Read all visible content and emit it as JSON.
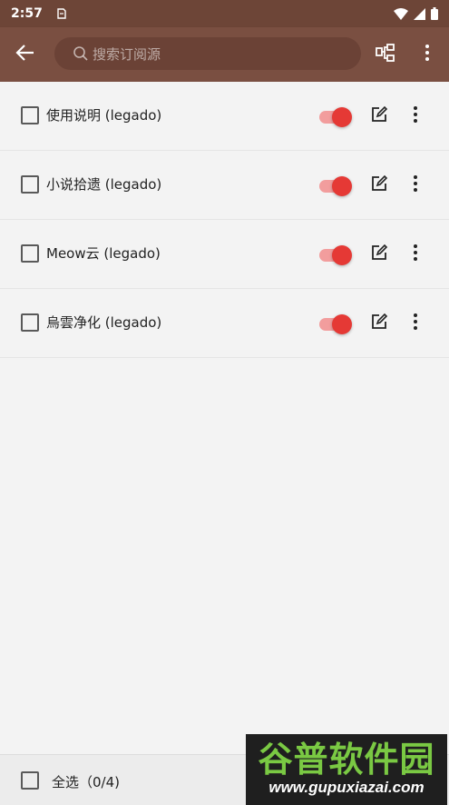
{
  "status_bar": {
    "time": "2:57",
    "notification_icon": "notification-icon",
    "wifi_icon": "wifi-icon",
    "signal_icon": "signal-icon",
    "battery_icon": "battery-icon"
  },
  "toolbar": {
    "back_icon": "arrow-left-icon",
    "search_placeholder": "搜索订阅源",
    "group_icon": "group-icon",
    "menu_icon": "more-vert-icon",
    "background_color": "#7a4f41"
  },
  "items": [
    {
      "label": "使用说明 (legado)",
      "checked": false,
      "enabled": true
    },
    {
      "label": "小说拾遗 (legado)",
      "checked": false,
      "enabled": true
    },
    {
      "label": "Meow云 (legado)",
      "checked": false,
      "enabled": true
    },
    {
      "label": "烏雲净化 (legado)",
      "checked": false,
      "enabled": true
    }
  ],
  "colors": {
    "accent": "#e53935",
    "switch_track": "#f29d9d"
  },
  "bottom": {
    "select_all_label": "全选（0/4)"
  },
  "watermark": {
    "title": "谷普软件园",
    "url": "www.gupuxiazai.com"
  }
}
